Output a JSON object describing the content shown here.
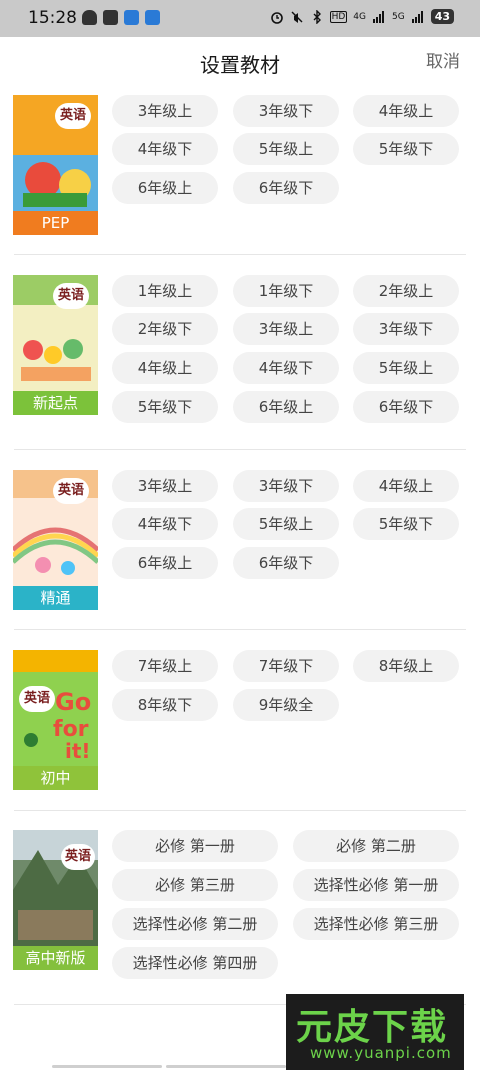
{
  "status_bar": {
    "time": "15:28",
    "network_1": "HD",
    "network_2": "4G",
    "network_3": "5G",
    "battery": "43"
  },
  "header": {
    "title": "设置教材",
    "cancel_label": "取消"
  },
  "books": [
    {
      "cover_title": "英语",
      "label": "PEP",
      "label_color": "#f07c1f",
      "grades": [
        "3年级上",
        "3年级下",
        "4年级上",
        "4年级下",
        "5年级上",
        "5年级下",
        "6年级上",
        "6年级下"
      ]
    },
    {
      "cover_title": "英语",
      "label": "新起点",
      "label_color": "#7cc23a",
      "grades": [
        "1年级上",
        "1年级下",
        "2年级上",
        "2年级下",
        "3年级上",
        "3年级下",
        "4年级上",
        "4年级下",
        "5年级上",
        "5年级下",
        "6年级上",
        "6年级下"
      ]
    },
    {
      "cover_title": "英语",
      "label": "精通",
      "label_color": "#2bb3c8",
      "grades": [
        "3年级上",
        "3年级下",
        "4年级上",
        "4年级下",
        "5年级上",
        "5年级下",
        "6年级上",
        "6年级下"
      ]
    },
    {
      "cover_title": "英语",
      "label": "初中",
      "label_color": "#8fc33a",
      "grades": [
        "7年级上",
        "7年级下",
        "8年级上",
        "8年级下",
        "9年级全"
      ]
    },
    {
      "cover_title": "英语",
      "label": "高中新版",
      "label_color": "#84c03d",
      "grades": [
        "必修 第一册",
        "必修 第二册",
        "必修 第三册",
        "选择性必修 第一册",
        "选择性必修 第二册",
        "选择性必修 第三册",
        "选择性必修 第四册"
      ]
    }
  ],
  "watermark": {
    "text": "元皮下载",
    "url": "www.yuanpi.com"
  },
  "icons": [
    "android-icon",
    "mail-icon",
    "app-icon",
    "telegram-icon",
    "alarm-icon",
    "mute-icon",
    "bluetooth-icon",
    "signal-icon",
    "wifi-icon"
  ]
}
